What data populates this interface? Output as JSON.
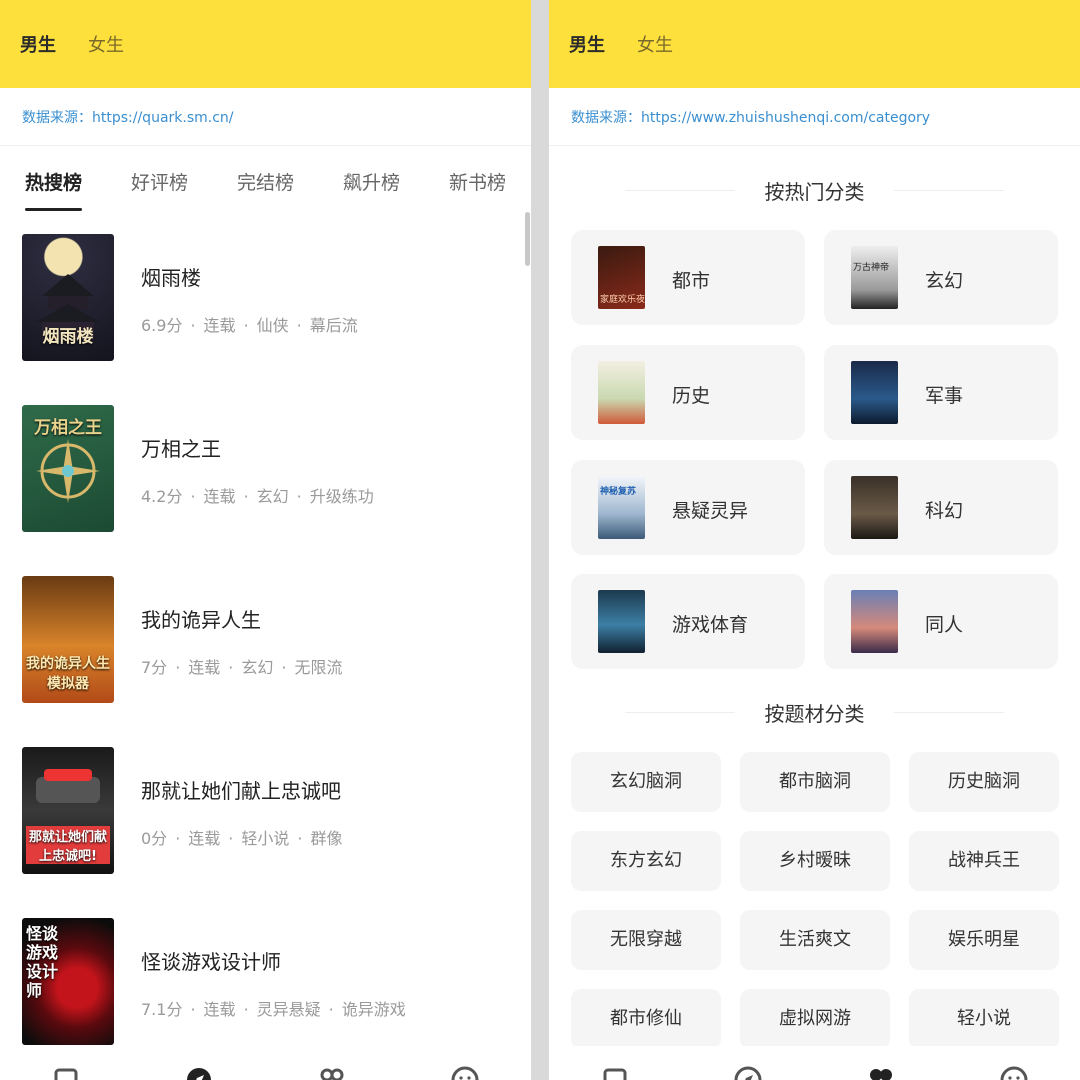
{
  "left": {
    "gender_tabs": [
      "男生",
      "女生"
    ],
    "source_label": "数据来源：https://quark.sm.cn/",
    "rank_tabs": [
      "热搜榜",
      "好评榜",
      "完结榜",
      "飙升榜",
      "新书榜"
    ],
    "books": [
      {
        "title": "烟雨楼",
        "meta": [
          "6.9分",
          "连载",
          "仙侠",
          "幕后流"
        ],
        "cover_text": "烟雨楼"
      },
      {
        "title": "万相之王",
        "meta": [
          "4.2分",
          "连载",
          "玄幻",
          "升级练功"
        ],
        "cover_text": "万相之王"
      },
      {
        "title": "我的诡异人生",
        "meta": [
          "7分",
          "连载",
          "玄幻",
          "无限流"
        ],
        "cover_text": "我的诡异人生模拟器"
      },
      {
        "title": "那就让她们献上忠诚吧",
        "meta": [
          "0分",
          "连载",
          "轻小说",
          "群像"
        ],
        "cover_text": "那就让她们献上忠诚吧!"
      },
      {
        "title": "怪谈游戏设计师",
        "meta": [
          "7.1分",
          "连载",
          "灵异悬疑",
          "诡异游戏"
        ],
        "cover_text": "怪谈游戏设计师"
      }
    ]
  },
  "right": {
    "gender_tabs": [
      "男生",
      "女生"
    ],
    "source_label": "数据来源：https://www.zhuishushenqi.com/category",
    "hot_section_title": "按热门分类",
    "hot_categories": [
      {
        "label": "都市",
        "cover_text": "家庭欢乐夜"
      },
      {
        "label": "玄幻",
        "cover_text": "万古神帝"
      },
      {
        "label": "历史",
        "cover_text": ""
      },
      {
        "label": "军事",
        "cover_text": ""
      },
      {
        "label": "悬疑灵异",
        "cover_text": "神秘复苏"
      },
      {
        "label": "科幻",
        "cover_text": ""
      },
      {
        "label": "游戏体育",
        "cover_text": ""
      },
      {
        "label": "同人",
        "cover_text": ""
      }
    ],
    "theme_section_title": "按题材分类",
    "theme_tags": [
      "玄幻脑洞",
      "都市脑洞",
      "历史脑洞",
      "东方玄幻",
      "乡村暧昧",
      "战神兵王",
      "无限穿越",
      "生活爽文",
      "娱乐明星",
      "都市修仙",
      "虚拟网游",
      "轻小说"
    ]
  },
  "colors": {
    "topbar": "#fde03b",
    "source_link": "#3a8fd0",
    "card_bg": "#f5f5f5"
  }
}
